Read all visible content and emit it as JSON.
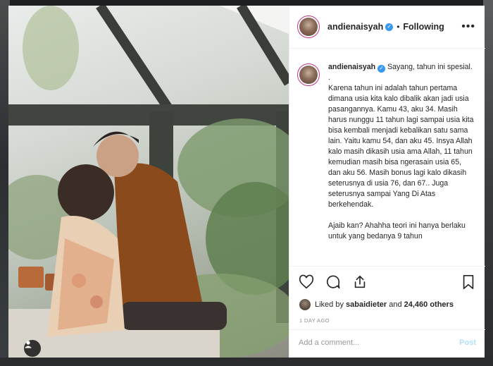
{
  "post": {
    "username": "andienaisyah",
    "verified_icon": "verified-badge-icon",
    "follow_status": "Following",
    "more_icon": "more-options-icon",
    "caption_paragraphs": [
      "Sayang, tahun ini spesial.",
      ".",
      "Karena tahun ini adalah tahun pertama dimana usia kita kalo dibalik akan jadi usia pasangannya. Kamu 43, aku 34. Masih harus nunggu 11 tahun lagi sampai usia kita bisa kembali menjadi kebalikan satu sama lain. Yaitu kamu 54, dan aku 45. Insya Allah kalo masih dikasih usia ama Allah, 11 tahun kemudian masih bisa ngerasain usia 65, dan aku 56. Masih bonus lagi kalo dikasih seterusnya di usia 76, dan 67.. Juga seterusnya sampai Yang Di Atas berkehendak.",
      "",
      "Ajaib kan? Ahahha teori ini hanya berlaku untuk yang bedanya 9 tahun"
    ],
    "likes": {
      "prefix": "Liked by ",
      "user": "sabaidieter",
      "and": " and ",
      "count": "24,460 others"
    },
    "timestamp": "1 DAY AGO",
    "comment": {
      "placeholder": "Add a comment...",
      "post_label": "Post"
    }
  },
  "icons": {
    "like": "heart-icon",
    "comment": "comment-icon",
    "share": "share-icon",
    "save": "bookmark-icon",
    "tagged_user": "user-tag-icon"
  },
  "colors": {
    "verified": "#3897f0",
    "post_button_disabled": "#b2dffc",
    "meta_gray": "#8e8e8e"
  }
}
